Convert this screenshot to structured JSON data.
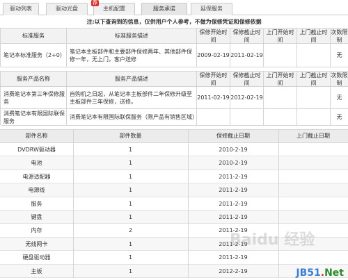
{
  "tabs": [
    {
      "label": "驱动列表"
    },
    {
      "label": "驱动光盘"
    },
    {
      "label": "主机配置",
      "badge": "荐"
    },
    {
      "label": "服务承诺"
    },
    {
      "label": "延保服务"
    }
  ],
  "note": "注:以下查询到的信息，仅供用户个人参考，不做为保修凭证和保修依据",
  "standard": {
    "headers": [
      "标准服务",
      "标准服务描述",
      "保修开始时间",
      "保修截止时间",
      "上门开始时间",
      "上门截止时间",
      "次数限制"
    ],
    "row": [
      "笔记本标准服务（2+0）",
      "笔记本主板部件和主要部件保修两年、其他部件保修一年，无上门，客户送修",
      "2009-02-19",
      "2011-02-19",
      "",
      "",
      "无"
    ]
  },
  "products": {
    "headers": [
      "服务产品名称",
      "服务产品描述",
      "保修开始时间",
      "保修截止时间",
      "上门开始时间",
      "上门截止时间",
      "次数限制"
    ],
    "rows": [
      [
        "消费笔记本第三年保修服务",
        "自购机之日起，从笔记本主板部件二年保修升级至主板部件三年保修，送修。",
        "2011-02-19",
        "2012-02-19",
        "",
        "",
        "无"
      ],
      [
        "消费笔记本有限国际联保服务",
        "消费笔记本有限国际联保服务（限产品有销售区域）",
        "",
        "",
        "",
        "",
        "无"
      ]
    ]
  },
  "parts": {
    "headers": [
      "部件名称",
      "部件数量",
      "保修截止日期",
      "上门截止日期"
    ],
    "rows": [
      [
        "DVDRW驱动器",
        "1",
        "2010-2-19",
        ""
      ],
      [
        "电池",
        "1",
        "2010-2-19",
        ""
      ],
      [
        "电源适配器",
        "1",
        "2011-2-19",
        ""
      ],
      [
        "电源线",
        "1",
        "2011-2-19",
        ""
      ],
      [
        "服务",
        "1",
        "2011-2-19",
        ""
      ],
      [
        "键盘",
        "1",
        "2011-2-19",
        ""
      ],
      [
        "内存",
        "2",
        "2011-2-19",
        ""
      ],
      [
        "无线网卡",
        "1",
        "2011-2-19",
        ""
      ],
      [
        "硬盘驱动器",
        "1",
        "2011-2-19",
        ""
      ],
      [
        "主板",
        "1",
        "2012-2-19",
        ""
      ]
    ]
  },
  "watermark": {
    "site": "JB51",
    "dot": ".",
    "tld": "Net",
    "baidu": "Baidu 经验"
  }
}
